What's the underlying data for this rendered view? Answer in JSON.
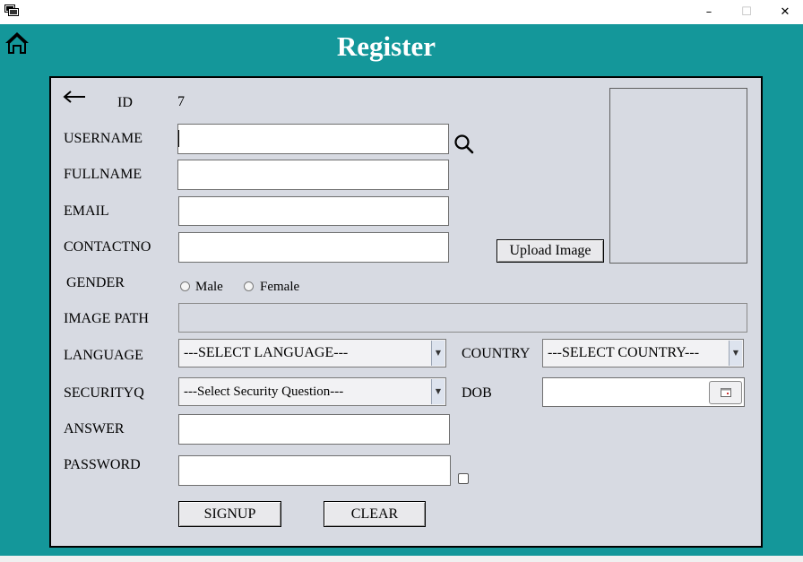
{
  "window": {
    "minimize": "–",
    "maximize": "☐",
    "close": "✕"
  },
  "title": "Register",
  "form": {
    "id_label": "ID",
    "id_value": "7",
    "username_label": "USERNAME",
    "fullname_label": "FULLNAME",
    "email_label": "EMAIL",
    "contactno_label": "CONTACTNO",
    "gender_label": "GENDER",
    "male_label": "Male",
    "female_label": "Female",
    "image_path_label": "IMAGE PATH",
    "language_label": "LANGUAGE",
    "language_selected": "---SELECT LANGUAGE---",
    "country_label": "COUNTRY",
    "country_selected": "---SELECT COUNTRY---",
    "securityq_label": "SECURITYQ",
    "securityq_selected": "---Select Security Question---",
    "dob_label": "DOB",
    "answer_label": "ANSWER",
    "password_label": "PASSWORD",
    "upload_label": "Upload Image",
    "signup_label": "SIGNUP",
    "clear_label": "CLEAR"
  },
  "icons": {
    "home": "home-icon",
    "back": "back-arrow-icon",
    "search": "search-icon",
    "calendar": "calendar-icon"
  },
  "colors": {
    "header_bg": "#14979a",
    "panel_bg": "#d7dae2",
    "title_text": "#ffffff"
  }
}
